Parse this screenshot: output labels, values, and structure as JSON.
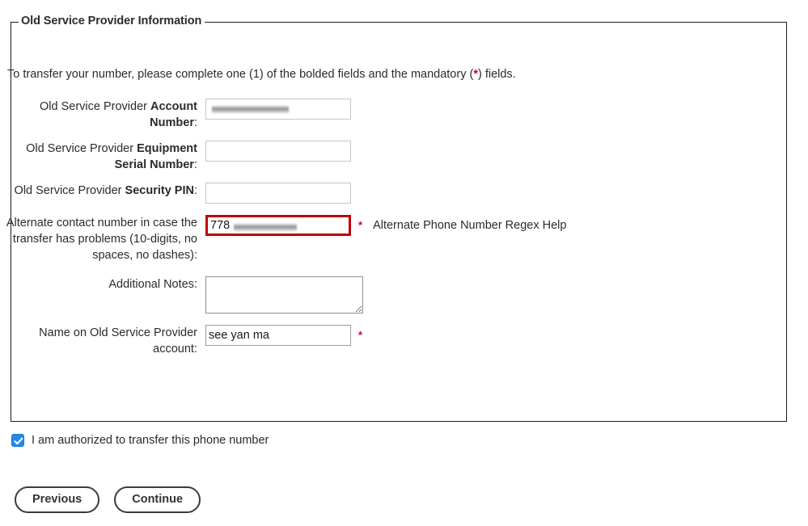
{
  "fieldset": {
    "legend": "Old Service Provider Information",
    "intro_before": "To transfer your number, please complete one (1) of the bolded fields and the mandatory (",
    "intro_star": "*",
    "intro_after": ") fields."
  },
  "fields": [
    {
      "label_prefix": "Old Service Provider ",
      "label_bold": "Account Number",
      "label_suffix": ":",
      "value": "",
      "redacted": true,
      "required": false,
      "error": false,
      "helper": ""
    },
    {
      "label_prefix": "Old Service Provider ",
      "label_bold": "Equipment Serial Number",
      "label_suffix": ":",
      "value": "",
      "redacted": false,
      "required": false,
      "error": false,
      "helper": ""
    },
    {
      "label_prefix": "Old Service Provider ",
      "label_bold": "Security PIN",
      "label_suffix": ":",
      "value": "",
      "redacted": false,
      "required": false,
      "error": false,
      "helper": ""
    },
    {
      "label_prefix": "Alternate contact number in case the transfer has problems (10-digits, no spaces, no dashes)",
      "label_bold": "",
      "label_suffix": ":",
      "value": "778",
      "redacted": true,
      "required": true,
      "error": true,
      "helper": "Alternate Phone Number Regex Help"
    }
  ],
  "notes_field": {
    "label": "Additional Notes:",
    "value": "",
    "placeholder": ""
  },
  "name_field": {
    "label": "Name on Old Service Provider account:",
    "value": "see yan ma",
    "required": true
  },
  "authorization": {
    "checked": true,
    "label": "I am authorized to transfer this phone number"
  },
  "buttons": {
    "previous": "Previous",
    "continue": "Continue"
  },
  "colors": {
    "required_star": "#d0021b",
    "error_border": "#c00000",
    "checkbox": "#1f8cf0"
  }
}
